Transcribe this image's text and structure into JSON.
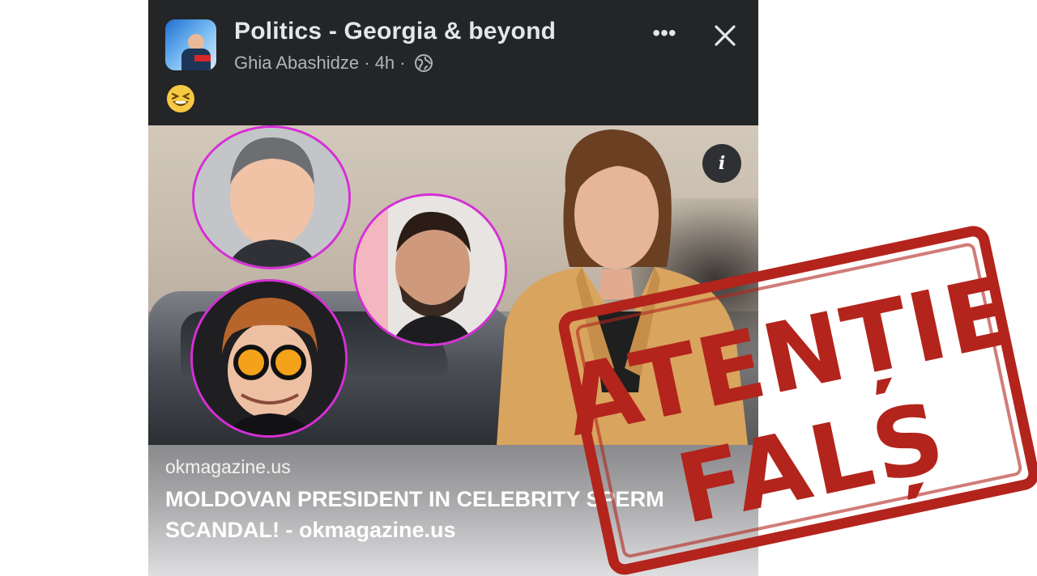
{
  "post": {
    "group_name": "Politics - Georgia & beyond",
    "author": "Ghia Abashidze",
    "separator": "·",
    "time": "4h",
    "more_label": "•••",
    "info_label": "i"
  },
  "link_preview": {
    "domain": "okmagazine.us",
    "headline": "MOLDOVAN PRESIDENT IN CELEBRITY SPERM SCANDAL! - okmagazine.us"
  },
  "stamp": {
    "line1": "ATENȚIE",
    "line2": "FALȘ",
    "color": "#b3241c"
  },
  "icons": {
    "globe": "globe-icon",
    "close": "close-icon",
    "more": "more-options-icon",
    "emoji": "grinning-squinting-face-emoji"
  },
  "colors": {
    "post_bg": "#242526",
    "highlight_ring": "#d62fd6",
    "stamp_red": "#b3241c"
  }
}
